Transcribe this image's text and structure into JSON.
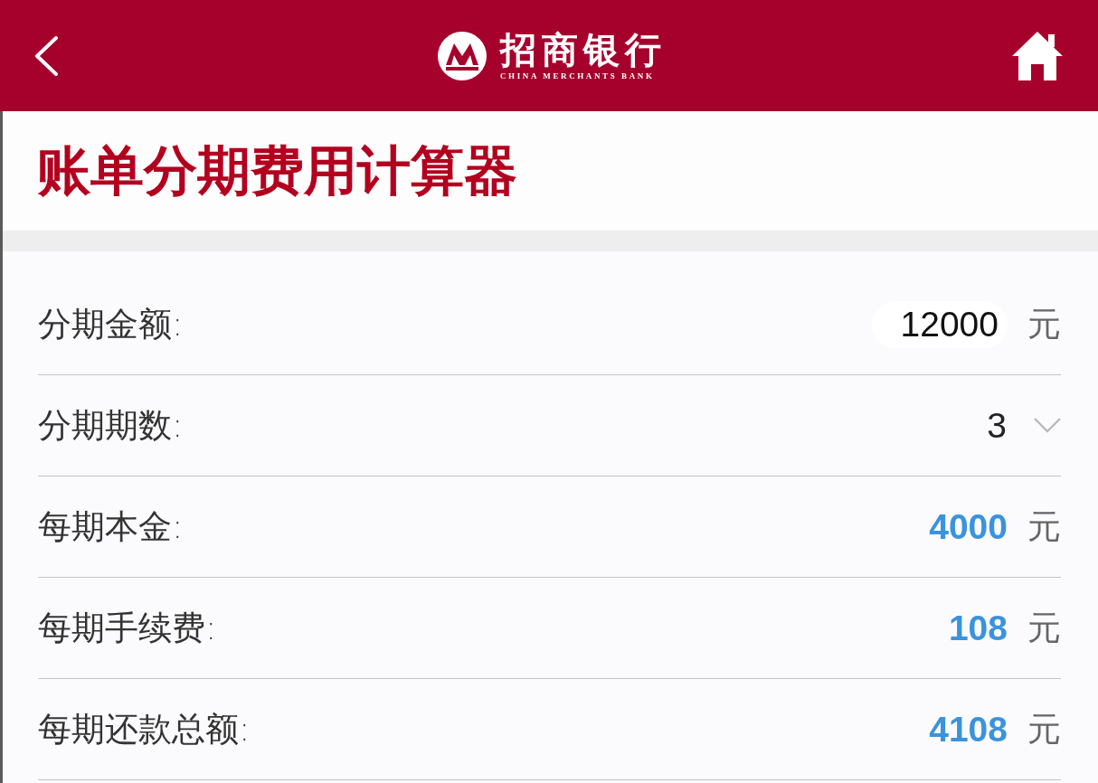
{
  "header": {
    "brand_name": "招商银行",
    "brand_subtitle": "CHINA MERCHANTS BANK"
  },
  "title": "账单分期费用计算器",
  "fields": [
    {
      "kind": "input",
      "label": "分期金额:",
      "value": "12000",
      "unit": "元"
    },
    {
      "kind": "select",
      "label": "分期期数:",
      "value": "3"
    },
    {
      "kind": "result",
      "label": "每期本金:",
      "value": "4000",
      "unit": "元"
    },
    {
      "kind": "result",
      "label": "每期手续费:",
      "value": "108",
      "unit": "元"
    },
    {
      "kind": "result",
      "label": "每期还款总额:",
      "value": "4108",
      "unit": "元"
    }
  ]
}
